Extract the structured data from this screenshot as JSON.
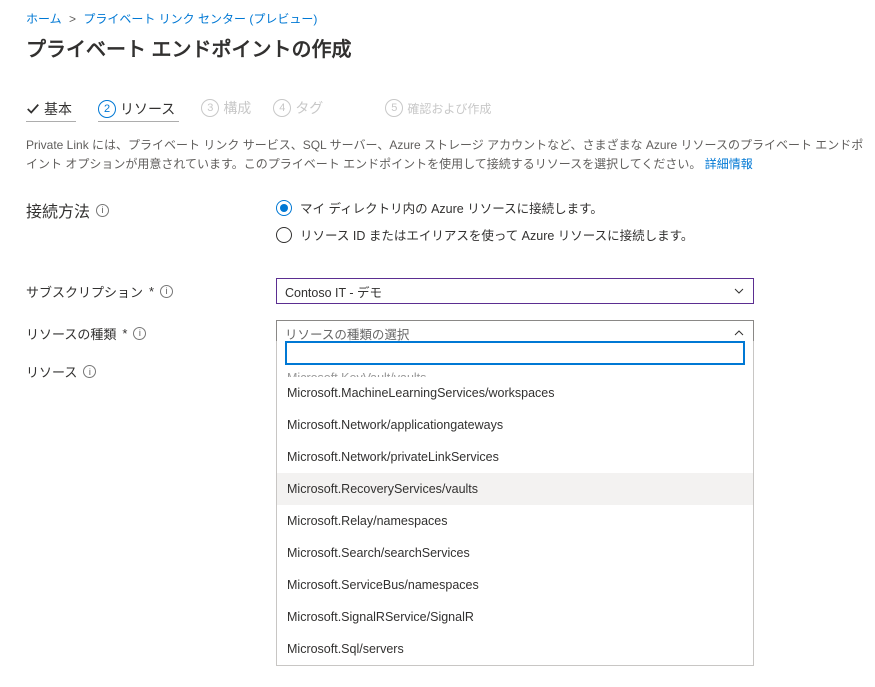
{
  "breadcrumb": {
    "home": "ホーム",
    "center": "プライベート リンク センター (プレビュー)"
  },
  "title": "プライベート エンドポイントの作成",
  "steps": {
    "s1": "基本",
    "s2_num": "2",
    "s2": "リソース",
    "s3_num": "3",
    "s3": "構成",
    "s4_num": "4",
    "s4": "タグ",
    "s5_num": "5",
    "s5": "確認および作成"
  },
  "description": "Private Link には、プライベート リンク サービス、SQL サーバー、Azure ストレージ アカウントなど、さまざまな Azure リソースのプライベート エンドポイント オプションが用意されています。このプライベート エンドポイントを使用して接続するリソースを選択してください。",
  "description_link": "詳細情報",
  "form": {
    "connection_method_label": "接続方法",
    "radio1": "マイ ディレクトリ内の Azure リソースに接続します。",
    "radio2": "リソース ID またはエイリアスを使って Azure リソースに接続します。",
    "subscription_label": "サブスクリプション",
    "subscription_value": "Contoso IT - デモ",
    "resource_type_label": "リソースの種類",
    "resource_type_placeholder": "リソースの種類の選択",
    "resource_label": "リソース",
    "required_mark": "*"
  },
  "dropdown": {
    "search_placeholder": "",
    "items": [
      "Microsoft.KeyVault/vaults",
      "Microsoft.MachineLearningServices/workspaces",
      "Microsoft.Network/applicationgateways",
      "Microsoft.Network/privateLinkServices",
      "Microsoft.RecoveryServices/vaults",
      "Microsoft.Relay/namespaces",
      "Microsoft.Search/searchServices",
      "Microsoft.ServiceBus/namespaces",
      "Microsoft.SignalRService/SignalR",
      "Microsoft.Sql/servers"
    ],
    "hovered_index": 4,
    "cut_first": true
  }
}
